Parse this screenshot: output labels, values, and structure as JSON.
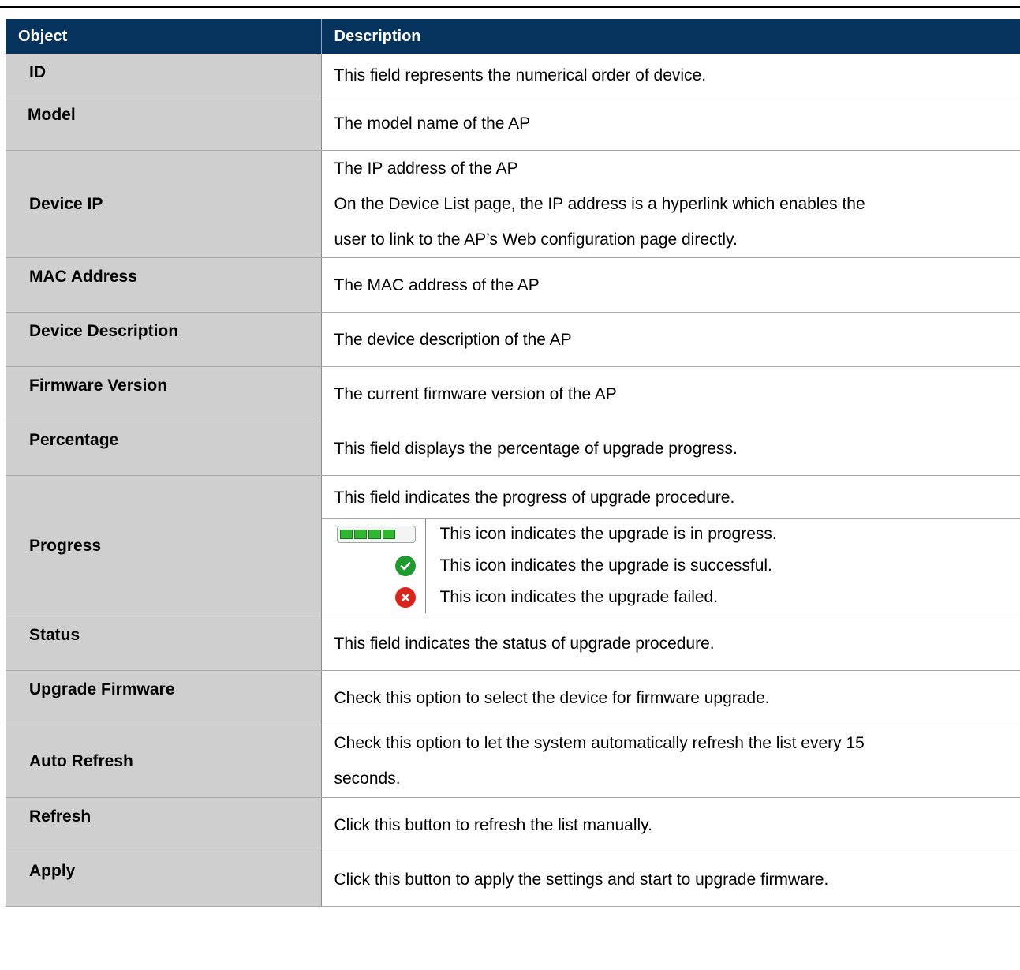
{
  "table": {
    "headers": {
      "object": "Object",
      "description": "Description"
    },
    "rows": [
      {
        "object": "ID",
        "description": [
          "This field represents the numerical order of device."
        ]
      },
      {
        "object": "Model",
        "description": [
          "The model name of the AP"
        ]
      },
      {
        "object": "Device IP",
        "description": [
          "The IP address of the AP",
          "On the Device List page, the IP address is a hyperlink which enables the",
          "user to link to the AP’s Web configuration page directly."
        ]
      },
      {
        "object": "MAC Address",
        "description": [
          "The MAC address of the AP"
        ]
      },
      {
        "object": "Device Description",
        "description": [
          "The device description of the AP"
        ]
      },
      {
        "object": "Firmware Version",
        "description": [
          "The current firmware version of the AP"
        ]
      },
      {
        "object": "Percentage",
        "description": [
          "This field displays the percentage of upgrade progress."
        ]
      },
      {
        "object": "Progress",
        "description": [
          "This field indicates the progress of upgrade procedure."
        ],
        "icons": [
          {
            "icon": "progress-bar-icon",
            "text": "This icon indicates the upgrade is in progress."
          },
          {
            "icon": "success-check-icon",
            "text": "This icon indicates the upgrade is successful.",
            "color": "#1e9a2e"
          },
          {
            "icon": "fail-x-icon",
            "text": "This icon indicates the upgrade failed.",
            "color": "#d9251d"
          }
        ]
      },
      {
        "object": "Status",
        "description": [
          "This field indicates the status of upgrade procedure."
        ]
      },
      {
        "object": "Upgrade Firmware",
        "description": [
          "Check this option to select the device for firmware upgrade."
        ]
      },
      {
        "object": "Auto Refresh",
        "description": [
          "Check this option to let the system automatically refresh the list every 15",
          "seconds."
        ]
      },
      {
        "object": "Refresh",
        "description": [
          "Click this button to refresh the list manually."
        ]
      },
      {
        "object": "Apply",
        "description": [
          "Click this button to apply the settings and start to upgrade firmware."
        ]
      }
    ]
  },
  "colors": {
    "header_bg": "#06325e",
    "object_bg": "#cfcfcf"
  }
}
